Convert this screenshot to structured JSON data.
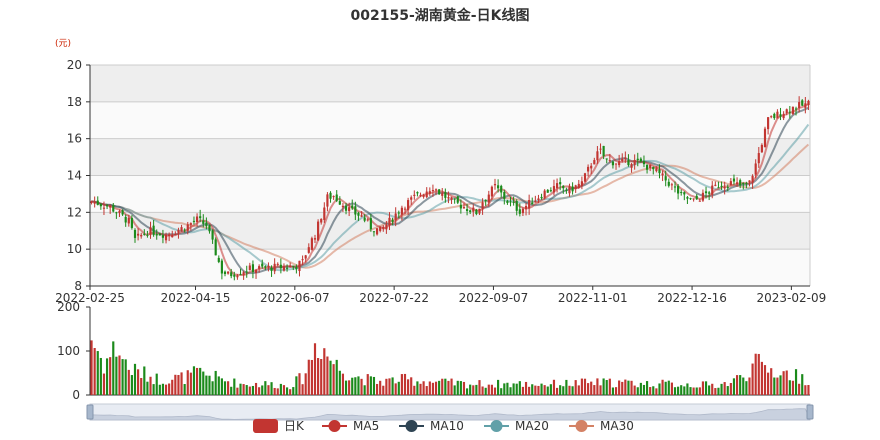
{
  "title": "002155-湖南黄金-日K线图",
  "unit_label": "(元)",
  "colors": {
    "up": "#c23531",
    "down": "#1b8a1b",
    "ma5": "#c23531",
    "ma10": "#2f4554",
    "ma20": "#61a0a8",
    "ma30": "#d48265",
    "band": "#eeeeee"
  },
  "legend": [
    {
      "key": "kline",
      "label": "日K",
      "color": "#c23531",
      "icon": "rect-icon"
    },
    {
      "key": "ma5",
      "label": "MA5",
      "color": "#c23531",
      "icon": "circle-line-icon"
    },
    {
      "key": "ma10",
      "label": "MA10",
      "color": "#2f4554",
      "icon": "circle-line-icon"
    },
    {
      "key": "ma20",
      "label": "MA20",
      "color": "#61a0a8",
      "icon": "circle-line-icon"
    },
    {
      "key": "ma30",
      "label": "MA30",
      "color": "#d48265",
      "icon": "circle-line-icon"
    }
  ],
  "chart_data": {
    "type": "candlestick",
    "title": "002155-湖南黄金-日K线图",
    "y_unit": "(元)",
    "price_ylim": [
      8,
      20
    ],
    "price_yticks": [
      "20",
      "18",
      "16",
      "14",
      "12",
      "10",
      "8"
    ],
    "volume_ylim": [
      0,
      200
    ],
    "volume_yticks": [
      "200",
      "100",
      "0"
    ],
    "x_tick_labels": [
      "2022-02-25",
      "2022-04-15",
      "2022-06-07",
      "2022-07-22",
      "2022-09-07",
      "2022-11-01",
      "2022-12-16",
      "2023-02-09"
    ],
    "x_tick_index": [
      0,
      34,
      66,
      98,
      130,
      162,
      194,
      226
    ],
    "total_days": 232,
    "close_keypoints": [
      [
        0,
        12.6
      ],
      [
        6,
        12.3
      ],
      [
        12,
        11.5
      ],
      [
        14,
        10.5
      ],
      [
        18,
        11.0
      ],
      [
        24,
        10.8
      ],
      [
        30,
        11.2
      ],
      [
        34,
        11.6
      ],
      [
        37,
        11.3
      ],
      [
        40,
        9.8
      ],
      [
        42,
        8.8
      ],
      [
        44,
        8.6
      ],
      [
        50,
        8.9
      ],
      [
        58,
        9.0
      ],
      [
        66,
        9.1
      ],
      [
        68,
        9.3
      ],
      [
        70,
        10.2
      ],
      [
        72,
        10.8
      ],
      [
        74,
        11.8
      ],
      [
        76,
        12.8
      ],
      [
        78,
        12.9
      ],
      [
        82,
        12.3
      ],
      [
        84,
        12.0
      ],
      [
        87,
        11.8
      ],
      [
        90,
        11.2
      ],
      [
        93,
        11.0
      ],
      [
        96,
        11.5
      ],
      [
        100,
        12.3
      ],
      [
        104,
        12.8
      ],
      [
        108,
        13.2
      ],
      [
        110,
        13.4
      ],
      [
        112,
        13.1
      ],
      [
        116,
        12.6
      ],
      [
        120,
        12.3
      ],
      [
        124,
        12.0
      ],
      [
        126,
        12.6
      ],
      [
        128,
        13.0
      ],
      [
        130,
        13.4
      ],
      [
        134,
        12.6
      ],
      [
        138,
        12.1
      ],
      [
        142,
        12.6
      ],
      [
        146,
        13.1
      ],
      [
        150,
        13.4
      ],
      [
        154,
        13.2
      ],
      [
        158,
        13.6
      ],
      [
        162,
        15.0
      ],
      [
        164,
        15.3
      ],
      [
        166,
        14.8
      ],
      [
        170,
        14.7
      ],
      [
        174,
        14.8
      ],
      [
        178,
        14.6
      ],
      [
        182,
        14.2
      ],
      [
        186,
        13.6
      ],
      [
        190,
        12.9
      ],
      [
        194,
        12.6
      ],
      [
        198,
        13.0
      ],
      [
        202,
        13.5
      ],
      [
        206,
        13.6
      ],
      [
        210,
        13.4
      ],
      [
        212,
        13.6
      ],
      [
        214,
        14.6
      ],
      [
        216,
        15.8
      ],
      [
        218,
        17.0
      ],
      [
        222,
        17.4
      ],
      [
        226,
        17.7
      ],
      [
        229,
        17.8
      ],
      [
        231,
        17.9
      ]
    ],
    "volume_keypoints": [
      [
        0,
        130
      ],
      [
        4,
        70
      ],
      [
        8,
        110
      ],
      [
        12,
        60
      ],
      [
        16,
        50
      ],
      [
        22,
        35
      ],
      [
        30,
        40
      ],
      [
        34,
        50
      ],
      [
        38,
        45
      ],
      [
        42,
        35
      ],
      [
        48,
        25
      ],
      [
        56,
        25
      ],
      [
        64,
        22
      ],
      [
        68,
        40
      ],
      [
        70,
        70
      ],
      [
        72,
        115
      ],
      [
        74,
        120
      ],
      [
        76,
        90
      ],
      [
        80,
        60
      ],
      [
        86,
        40
      ],
      [
        92,
        30
      ],
      [
        100,
        35
      ],
      [
        110,
        30
      ],
      [
        120,
        25
      ],
      [
        130,
        25
      ],
      [
        140,
        25
      ],
      [
        150,
        25
      ],
      [
        160,
        28
      ],
      [
        170,
        28
      ],
      [
        180,
        25
      ],
      [
        190,
        25
      ],
      [
        200,
        22
      ],
      [
        206,
        28
      ],
      [
        210,
        45
      ],
      [
        214,
        70
      ],
      [
        218,
        60
      ],
      [
        222,
        50
      ],
      [
        226,
        45
      ],
      [
        231,
        35
      ]
    ],
    "series": [
      {
        "name": "日K"
      },
      {
        "name": "MA5",
        "window": 5
      },
      {
        "name": "MA10",
        "window": 10
      },
      {
        "name": "MA20",
        "window": 20
      },
      {
        "name": "MA30",
        "window": 30
      }
    ]
  }
}
